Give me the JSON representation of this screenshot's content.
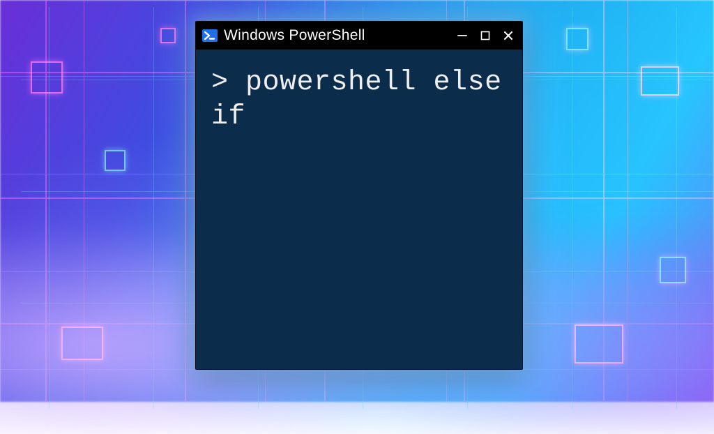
{
  "window": {
    "title": "Windows PowerShell",
    "icon": "powershell-icon",
    "controls": {
      "minimize": "minimize",
      "maximize": "maximize",
      "close": "close"
    }
  },
  "terminal": {
    "prompt": "> ",
    "command": "powershell else if"
  },
  "colors": {
    "titlebar_bg": "#000000",
    "terminal_bg": "#0b2c4a",
    "text": "#eeeeee",
    "ps_icon_bg": "#1f6feb"
  }
}
